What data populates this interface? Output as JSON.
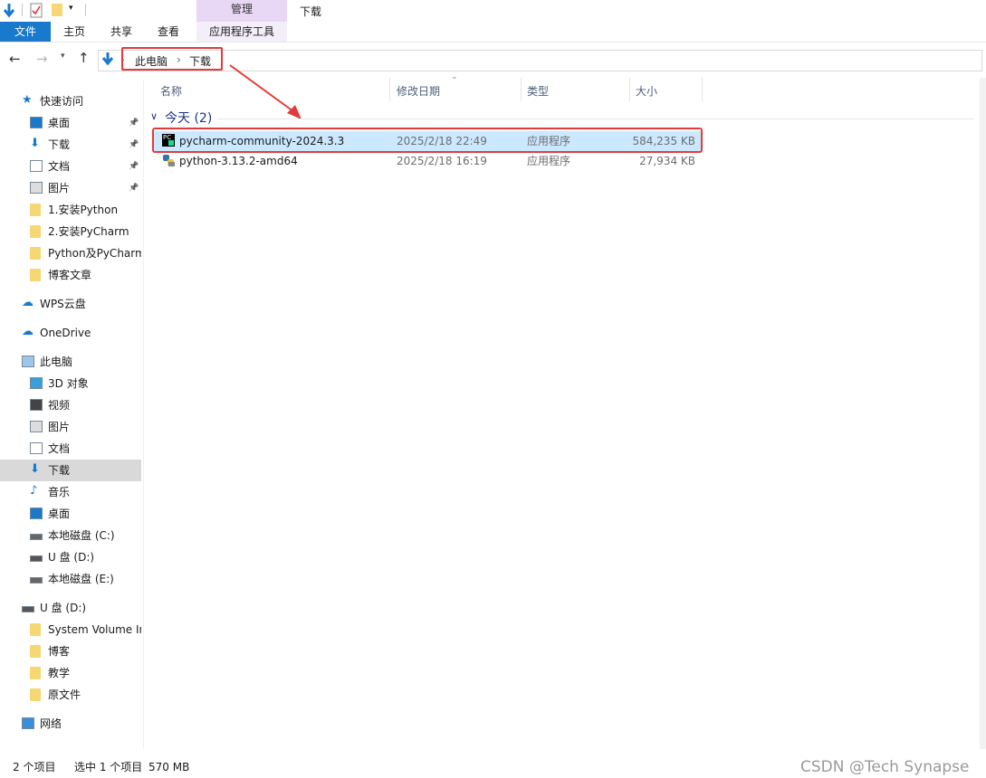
{
  "ribbon": {
    "context_group": "管理",
    "window_title": "下载",
    "tabs": [
      "文件",
      "主页",
      "共享",
      "查看",
      "应用程序工具"
    ]
  },
  "address": {
    "crumbs": [
      "此电脑",
      "下载"
    ],
    "separator": "›"
  },
  "sidebar": {
    "items": [
      {
        "label": "快速访问",
        "icon": "star-icon"
      },
      {
        "label": "桌面",
        "icon": "desktop-icon",
        "pinned": true
      },
      {
        "label": "下载",
        "icon": "download-icon",
        "pinned": true
      },
      {
        "label": "文档",
        "icon": "document-icon",
        "pinned": true
      },
      {
        "label": "图片",
        "icon": "picture-icon",
        "pinned": true
      },
      {
        "label": "1.安装Python",
        "icon": "folder-icon"
      },
      {
        "label": "2.安装PyCharm",
        "icon": "folder-icon"
      },
      {
        "label": "Python及PyCharm",
        "icon": "folder-icon"
      },
      {
        "label": "博客文章",
        "icon": "folder-icon"
      },
      {
        "label": "WPS云盘",
        "icon": "cloud-icon"
      },
      {
        "label": "OneDrive",
        "icon": "cloud-icon"
      },
      {
        "label": "此电脑",
        "icon": "computer-icon"
      },
      {
        "label": "3D 对象",
        "icon": "cube-icon"
      },
      {
        "label": "视频",
        "icon": "video-icon"
      },
      {
        "label": "图片",
        "icon": "picture-icon"
      },
      {
        "label": "文档",
        "icon": "document-icon"
      },
      {
        "label": "下载",
        "icon": "download-icon",
        "selected": true
      },
      {
        "label": "音乐",
        "icon": "music-icon"
      },
      {
        "label": "桌面",
        "icon": "desktop-icon"
      },
      {
        "label": "本地磁盘 (C:)",
        "icon": "drive-icon"
      },
      {
        "label": "U 盘 (D:)",
        "icon": "usb-drive-icon"
      },
      {
        "label": "本地磁盘 (E:)",
        "icon": "drive-icon"
      },
      {
        "label": "U 盘 (D:)",
        "icon": "usb-drive-icon"
      },
      {
        "label": "System Volume In",
        "icon": "folder-icon"
      },
      {
        "label": "博客",
        "icon": "folder-icon"
      },
      {
        "label": "教学",
        "icon": "folder-icon"
      },
      {
        "label": "原文件",
        "icon": "folder-icon"
      },
      {
        "label": "网络",
        "icon": "network-icon"
      }
    ]
  },
  "columns": [
    "名称",
    "修改日期",
    "类型",
    "大小"
  ],
  "group": {
    "label": "今天 (2)"
  },
  "files": [
    {
      "name": "pycharm-community-2024.3.3",
      "date": "2025/2/18 22:49",
      "type": "应用程序",
      "size": "584,235 KB",
      "selected": true,
      "icon": "pycharm-icon"
    },
    {
      "name": "python-3.13.2-amd64",
      "date": "2025/2/18 16:19",
      "type": "应用程序",
      "size": "27,934 KB",
      "selected": false,
      "icon": "python-installer-icon"
    }
  ],
  "status": {
    "count": "2 个项目",
    "selection": "选中 1 个项目",
    "size": "570 MB"
  },
  "watermark": "CSDN @Tech Synapse",
  "colors": {
    "accent": "#1979ca",
    "highlight": "#e23b3b",
    "selection": "#cce8ff",
    "context": "#e8d7f5"
  }
}
